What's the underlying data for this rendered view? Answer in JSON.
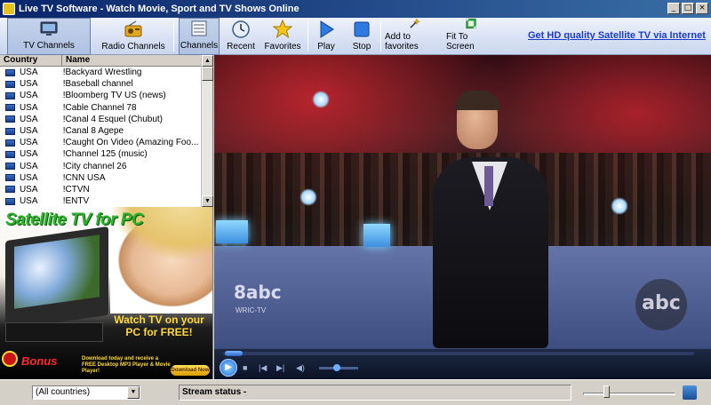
{
  "window": {
    "title": "Live TV Software - Watch Movie, Sport and TV Shows Online",
    "minimize": "_",
    "maximize": "□",
    "close": "×"
  },
  "toolbar": {
    "tv_channels": "TV Channels",
    "radio_channels": "Radio Channels",
    "channels": "Channels",
    "recent": "Recent",
    "favorites": "Favorites",
    "play": "Play",
    "stop": "Stop",
    "add_to_favorites": "Add to favorites",
    "fit_to_screen": "Fit To Screen",
    "hd_link": "Get HD quality Satellite TV via Internet"
  },
  "list": {
    "headers": {
      "country": "Country",
      "name": "Name"
    },
    "rows": [
      {
        "country": "USA",
        "name": "!Backyard Wrestling"
      },
      {
        "country": "USA",
        "name": "!Baseball channel"
      },
      {
        "country": "USA",
        "name": "!Bloomberg TV US (news)"
      },
      {
        "country": "USA",
        "name": "!Cable Channel 78"
      },
      {
        "country": "USA",
        "name": "!Canal 4 Esquel (Chubut)"
      },
      {
        "country": "USA",
        "name": "!Canal 8 Agepe"
      },
      {
        "country": "USA",
        "name": "!Caught On Video (Amazing Foo..."
      },
      {
        "country": "USA",
        "name": "!Channel 125 (music)"
      },
      {
        "country": "USA",
        "name": "!City channel 26"
      },
      {
        "country": "USA",
        "name": "!CNN USA"
      },
      {
        "country": "USA",
        "name": "!CTVN"
      },
      {
        "country": "USA",
        "name": "!ENTV"
      }
    ]
  },
  "ad": {
    "headline": "Satellite TV for PC",
    "watch_line1": "Watch TV on your",
    "watch_line2": "PC for FREE!",
    "bonus": "Bonus",
    "bonus_text": "Download today and receive a FREE Desktop MP3 Player & Movie Player!",
    "download": "Download Now"
  },
  "video": {
    "logo_left": "8abc",
    "logo_left_sub": "WRIC-TV",
    "logo_right": "abc"
  },
  "status": {
    "country_filter": "(All countries)",
    "stream_status": "Stream status -"
  }
}
